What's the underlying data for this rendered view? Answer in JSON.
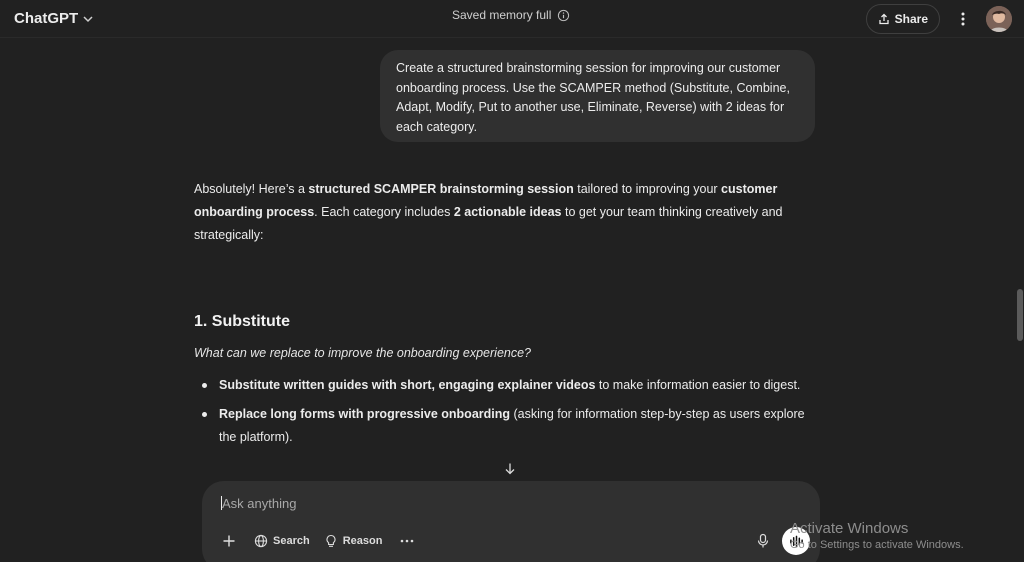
{
  "header": {
    "model_label": "ChatGPT",
    "memory_status": "Saved memory full",
    "share_label": "Share"
  },
  "conversation": {
    "user_message": "Create a structured brainstorming session for improving our customer onboarding process. Use the SCAMPER method (Substitute, Combine, Adapt, Modify, Put to another use, Eliminate, Reverse) with 2 ideas for each category.",
    "assistant_intro": [
      {
        "text": "Absolutely! Here’s a ",
        "bold": false
      },
      {
        "text": "structured SCAMPER brainstorming session",
        "bold": true
      },
      {
        "text": " tailored to improving your ",
        "bold": false
      },
      {
        "text": "customer onboarding process",
        "bold": true
      },
      {
        "text": ". Each category includes ",
        "bold": false
      },
      {
        "text": "2 actionable ideas",
        "bold": true
      },
      {
        "text": " to get your team thinking creatively and strategically:",
        "bold": false
      }
    ],
    "section_title": "1. Substitute",
    "section_question": "What can we replace to improve the onboarding experience?",
    "bullets": [
      {
        "bold": "Substitute written guides with short, engaging explainer videos",
        "rest": " to make information easier to digest."
      },
      {
        "bold": "Replace long forms with progressive onboarding",
        "rest": " (asking for information step-by-step as users explore the platform)."
      }
    ]
  },
  "composer": {
    "placeholder": "Ask anything",
    "search_label": "Search",
    "reason_label": "Reason"
  },
  "watermark": {
    "title": "Activate Windows",
    "subtitle": "Go to Settings to activate Windows."
  },
  "icons": [
    "chevron-down-icon",
    "info-icon",
    "share-icon",
    "kebab-icon",
    "arrow-down-icon",
    "plus-icon",
    "globe-icon",
    "bulb-icon",
    "more-icon",
    "mic-icon",
    "voice-wave-icon"
  ]
}
